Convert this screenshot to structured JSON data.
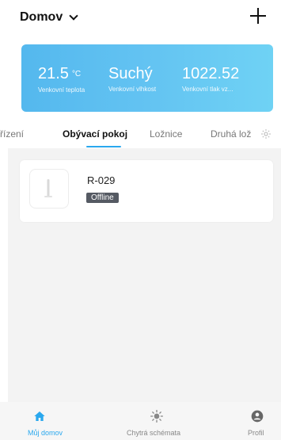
{
  "header": {
    "home_name": "Domov",
    "add_icon": "plus-icon"
  },
  "weather": {
    "temperature": {
      "value": "21.5",
      "unit": "°C",
      "label": "Venkovní teplota"
    },
    "humidity": {
      "value": "Suchý",
      "label": "Venkovní vlhkost"
    },
    "pressure": {
      "value": "1022.52",
      "label": "Venkovní tlak vz..."
    }
  },
  "tabs": [
    {
      "label": "řízení",
      "active": false
    },
    {
      "label": "Obývací pokoj",
      "active": true
    },
    {
      "label": "Ložnice",
      "active": false
    },
    {
      "label": "Druhá lož",
      "active": false
    }
  ],
  "tab_settings_icon": "gear-icon",
  "devices": [
    {
      "name": "R-029",
      "status": "Offline"
    }
  ],
  "bottom_nav": [
    {
      "label": "Můj domov",
      "icon": "home-icon",
      "active": true
    },
    {
      "label": "Chytrá schémata",
      "icon": "sun-icon",
      "active": false
    },
    {
      "label": "Profil",
      "icon": "profile-icon",
      "active": false
    }
  ],
  "colors": {
    "accent": "#2aa8ee",
    "weather_gradient_start": "#54b8ee",
    "weather_gradient_end": "#6fd2f4",
    "offline_badge": "#555a63"
  }
}
